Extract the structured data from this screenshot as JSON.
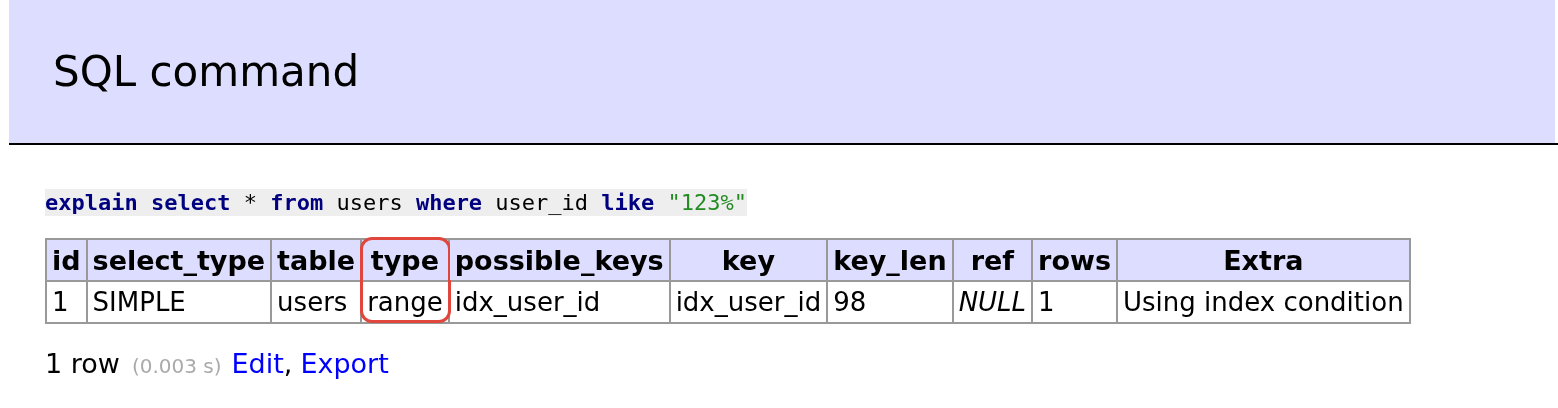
{
  "header": {
    "title": "SQL command"
  },
  "query": [
    {
      "text": "explain",
      "kind": "keyword"
    },
    {
      "text": " select",
      "kind": "keyword"
    },
    {
      "text": " * ",
      "kind": "plain"
    },
    {
      "text": "from",
      "kind": "keyword"
    },
    {
      "text": " users ",
      "kind": "plain"
    },
    {
      "text": "where",
      "kind": "keyword"
    },
    {
      "text": " user_id ",
      "kind": "plain"
    },
    {
      "text": "like ",
      "kind": "keyword"
    },
    {
      "text": "\"123%\"",
      "kind": "string"
    }
  ],
  "table": {
    "columns": [
      {
        "label": "id",
        "highlighted": false
      },
      {
        "label": "select_type",
        "highlighted": false
      },
      {
        "label": "table",
        "highlighted": false
      },
      {
        "label": "type",
        "highlighted": true
      },
      {
        "label": "possible_keys",
        "highlighted": false
      },
      {
        "label": "key",
        "highlighted": false
      },
      {
        "label": "key_len",
        "highlighted": false
      },
      {
        "label": "ref",
        "highlighted": false
      },
      {
        "label": "rows",
        "highlighted": false
      },
      {
        "label": "Extra",
        "highlighted": false
      }
    ],
    "rows": [
      [
        {
          "text": "1",
          "kind": "value"
        },
        {
          "text": "SIMPLE",
          "kind": "value"
        },
        {
          "text": "users",
          "kind": "value"
        },
        {
          "text": "range",
          "kind": "value"
        },
        {
          "text": "idx_user_id",
          "kind": "value"
        },
        {
          "text": "idx_user_id",
          "kind": "value"
        },
        {
          "text": "98",
          "kind": "value"
        },
        {
          "text": "NULL",
          "kind": "null"
        },
        {
          "text": "1",
          "kind": "value"
        },
        {
          "text": "Using index condition",
          "kind": "value"
        }
      ]
    ]
  },
  "footer": {
    "count": "1 row",
    "time": "(0.003 s)",
    "links": [
      "Edit",
      "Export"
    ],
    "separator": ","
  }
}
